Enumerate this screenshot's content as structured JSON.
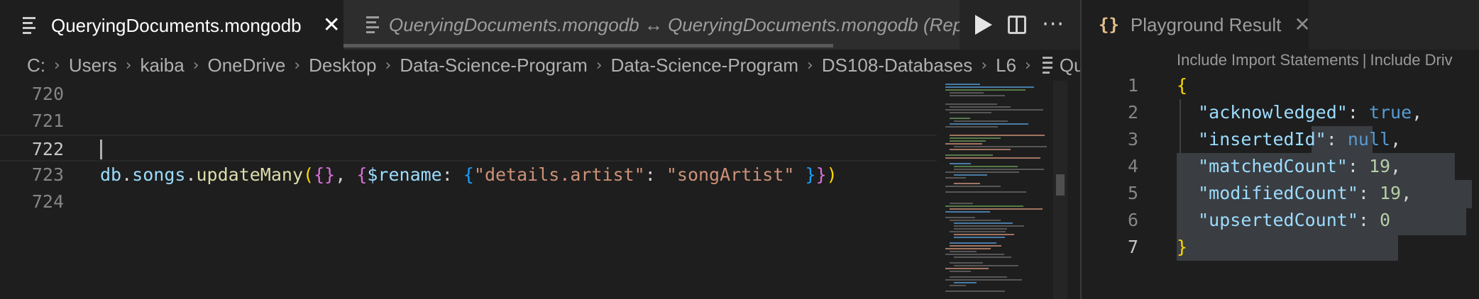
{
  "left_group": {
    "tabs": [
      {
        "label": "QueryingDocuments.mongodb",
        "active": true,
        "icon": "file-lines-icon"
      },
      {
        "label": "QueryingDocuments.mongodb ↔ QueryingDocuments.mongodb (Replac",
        "active": false,
        "icon": "file-lines-icon"
      }
    ],
    "actions": [
      "run-play-icon",
      "split-editor-icon",
      "more-actions-icon"
    ],
    "breadcrumb": [
      "C:",
      "Users",
      "kaiba",
      "OneDrive",
      "Desktop",
      "Data-Science-Program",
      "Data-Science-Program",
      "DS108-Databases",
      "L6",
      "Quer"
    ],
    "lines": [
      {
        "number": "720",
        "text": ""
      },
      {
        "number": "721",
        "text": ""
      },
      {
        "number": "722",
        "text": "",
        "current": true
      },
      {
        "number": "723",
        "tokens": [
          "db",
          ".",
          "songs",
          ".",
          "updateMany",
          "(",
          "{",
          "}",
          ", ",
          "{",
          "$rename",
          ": ",
          "{",
          "\"details.artist\"",
          ": ",
          "\"songArtist\"",
          " ",
          "}",
          "}",
          ")"
        ]
      },
      {
        "number": "724",
        "text": ""
      }
    ]
  },
  "right_group": {
    "tab": {
      "label": "Playground Result",
      "icon": "braces-icon"
    },
    "codelens": {
      "first": "Include Import Statements",
      "separator": "|",
      "second": "Include Driv"
    },
    "lines": [
      {
        "number": "1",
        "parts": [
          "{"
        ]
      },
      {
        "number": "2",
        "parts": [
          "\"acknowledged\"",
          ": ",
          "true",
          ","
        ]
      },
      {
        "number": "3",
        "parts": [
          "\"insertedId\"",
          ": ",
          "null",
          ","
        ]
      },
      {
        "number": "4",
        "parts": [
          "\"matchedCount\"",
          ": ",
          "19",
          ","
        ]
      },
      {
        "number": "5",
        "parts": [
          "\"modifiedCount\"",
          ": ",
          "19",
          ","
        ]
      },
      {
        "number": "6",
        "parts": [
          "\"upsertedCount\"",
          ": ",
          "0"
        ]
      },
      {
        "number": "7",
        "parts": [
          "}"
        ]
      }
    ]
  },
  "colors": {
    "background": "#1e1e1e",
    "string": "#ce9178",
    "property": "#9cdcfe",
    "function": "#dcdcaa",
    "keyword": "#569cd6",
    "number": "#b5cea8",
    "bracket_gold": "#ffd700",
    "bracket_purple": "#da70d6",
    "bracket_blue": "#179fff"
  }
}
